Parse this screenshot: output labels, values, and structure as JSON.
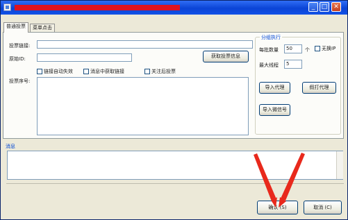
{
  "window": {
    "title_redacted": true,
    "min_glyph": "_",
    "max_glyph": "□",
    "close_glyph": "✕"
  },
  "tabs": [
    {
      "label": "普通投票",
      "active": true
    },
    {
      "label": "菜单点击",
      "active": false
    }
  ],
  "form": {
    "vote_link_label": "投票链接:",
    "vote_link_value": "",
    "original_id_label": "原始ID:",
    "original_id_value": "",
    "get_vote_info_button": "获取投票信息",
    "checkboxes": [
      {
        "label": "链接自动失效",
        "checked": false
      },
      {
        "label": "消息中获取链接",
        "checked": false
      },
      {
        "label": "关注后投票",
        "checked": false
      }
    ],
    "vote_sequence_label": "投票序号:",
    "vote_sequence_value": ""
  },
  "batch": {
    "title": "分组执行",
    "per_batch_label": "每批数量",
    "per_batch_value": "50",
    "per_batch_unit": "个",
    "no_ip_label": "无换IP",
    "max_threads_label": "最大线程",
    "max_threads_value": "5",
    "import_proxy_button": "导入代理",
    "fake_proxy_button": "假打代理",
    "import_wechat_button": "导入微信号"
  },
  "messages": {
    "title": "消息",
    "content": ""
  },
  "footer": {
    "confirm_button": "确认 (S)",
    "cancel_button": "取消 (C)"
  },
  "colors": {
    "titlebar": "#0b44d6",
    "redaction": "#e0131f",
    "annotation_arrow": "#e8291c",
    "window_bg": "#ece9d8"
  },
  "annotation_icon": "red-arrows-pointing-to-confirm"
}
